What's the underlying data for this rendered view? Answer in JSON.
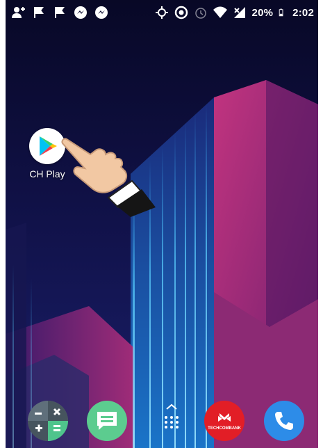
{
  "status_bar": {
    "battery_percent": "20%",
    "time": "2:02",
    "left_icons": [
      "add-contact-icon",
      "flag-icon",
      "flag-icon",
      "messenger-icon",
      "messenger-icon"
    ],
    "right_icons": [
      "location-icon",
      "target-icon",
      "alarm-icon",
      "wifi-icon",
      "signal-icon",
      "battery-icon"
    ]
  },
  "home": {
    "apps": [
      {
        "label": "CH Play",
        "icon": "play-store-icon"
      }
    ]
  },
  "dock": {
    "items": [
      {
        "icon": "calculator-icon"
      },
      {
        "icon": "messages-icon"
      },
      {
        "icon": "app-drawer-icon"
      },
      {
        "icon": "techcombank-icon",
        "brand_text": "TECHCOMBANK"
      },
      {
        "icon": "phone-icon"
      }
    ]
  },
  "colors": {
    "background": "#0a0a30",
    "pink": "#b8307a",
    "blue": "#1e5fb0",
    "techcombank_red": "#e21e26",
    "phone_blue": "#2d8ce8",
    "messages_green": "#5ccc8f"
  }
}
